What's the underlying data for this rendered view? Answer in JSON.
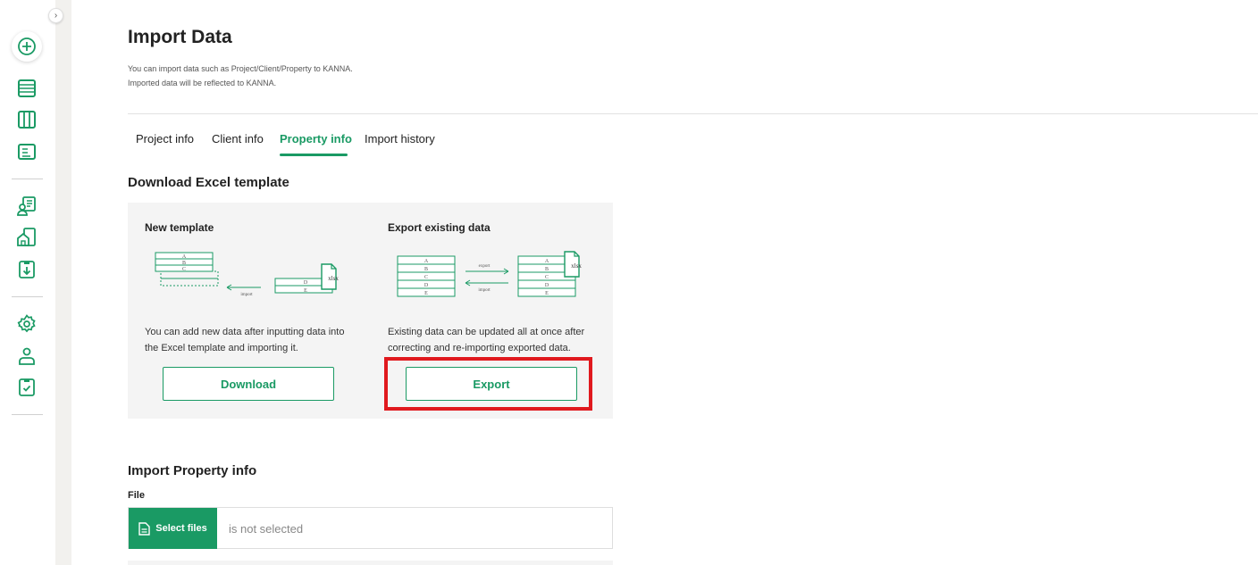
{
  "sidebar": {
    "toggle_glyph": "›",
    "icons": [
      "add-circle-icon",
      "list-icon",
      "columns-icon",
      "document-icon",
      "client-list-icon",
      "property-icon",
      "import-download-icon",
      "settings-gear-icon",
      "user-icon",
      "clipboard-check-icon"
    ],
    "accent": "#1a9a64"
  },
  "page": {
    "title": "Import Data",
    "desc_line1": "You can import data such as Project/Client/Property to KANNA.",
    "desc_line2": "Imported data will be reflected to KANNA."
  },
  "tabs": [
    {
      "label": "Project info",
      "active": false
    },
    {
      "label": "Client info",
      "active": false
    },
    {
      "label": "Property info",
      "active": true
    },
    {
      "label": "Import history",
      "active": false
    }
  ],
  "download_section": {
    "title": "Download Excel template",
    "new_template": {
      "title": "New template",
      "text": "You can add new data after inputting data into the Excel template and importing it.",
      "button": "Download",
      "illus": {
        "rows_left": [
          "A",
          "B",
          "C"
        ],
        "rows_right": [
          "D",
          "E"
        ],
        "arrow_label": "import",
        "file_label": "xlsx"
      }
    },
    "export_existing": {
      "title": "Export existing data",
      "text": "Existing data can be updated all at once after correcting and re-importing exported data.",
      "button": "Export",
      "illus": {
        "rows": [
          "A",
          "B",
          "C",
          "D",
          "E"
        ],
        "export_label": "export",
        "import_label": "import",
        "file_label": "xlsx"
      }
    }
  },
  "import_section": {
    "title": "Import Property info",
    "file_label": "File",
    "select_button": "Select files",
    "file_status": "is not selected"
  }
}
